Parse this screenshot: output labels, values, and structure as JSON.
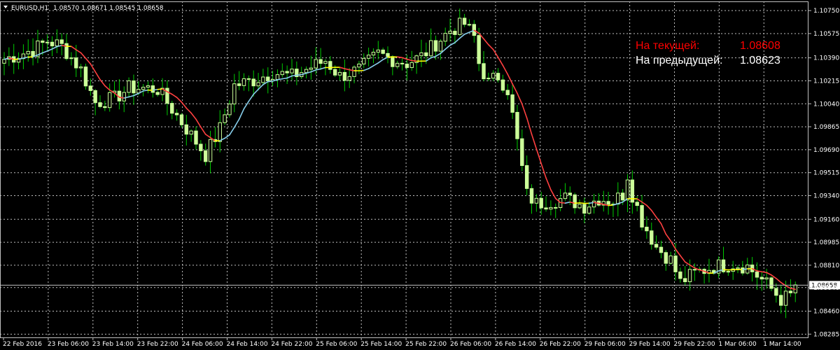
{
  "header": {
    "symbol": "EURUSD,H1",
    "ohlc": "1.08570 1.08671 1.08545 1.08658"
  },
  "info": {
    "current_label": "На текущей:",
    "current_value": "1.08608",
    "current_color": "#ff0000",
    "previous_label": "На предыдущей:",
    "previous_value": "1.08623",
    "previous_color": "#ffffff"
  },
  "colors": {
    "background": "#000000",
    "grid": "#c0c0c0",
    "bull_body": "#000000",
    "bull_outline": "#ccff99",
    "bear_body": "#ccff99",
    "wick": "#00cc00",
    "ma_up": "#87ceeb",
    "ma_down": "#ff4040",
    "ma_flat": "#ffff00",
    "price_line": "#c0c0c0",
    "price_label_bg": "#ffffff",
    "price_label_text": "#000000"
  },
  "chart_data": {
    "type": "candlestick",
    "symbol": "EURUSD",
    "timeframe": "H1",
    "ylim": [
      1.0826,
      1.1082
    ],
    "yticks": [
      "1.10750",
      "1.10575",
      "1.10390",
      "1.10215",
      "1.10040",
      "1.09865",
      "1.09690",
      "1.09515",
      "1.09340",
      "1.09160",
      "1.08985",
      "1.08810",
      "1.08640",
      "1.08460",
      "1.08285"
    ],
    "current_price": "1.08658",
    "xticks": [
      "22 Feb 2016",
      "23 Feb 06:00",
      "23 Feb 14:00",
      "23 Feb 22:00",
      "24 Feb 06:00",
      "24 Feb 14:00",
      "24 Feb 22:00",
      "25 Feb 06:00",
      "25 Feb 14:00",
      "25 Feb 22:00",
      "26 Feb 06:00",
      "26 Feb 14:00",
      "26 Feb 22:00",
      "29 Feb 06:00",
      "29 Feb 14:00",
      "29 Feb 22:00",
      "1 Mar 06:00",
      "1 Mar 14:00"
    ],
    "keypoints": [
      [
        0,
        1.1038
      ],
      [
        6,
        1.1045
      ],
      [
        9,
        1.1052
      ],
      [
        12,
        1.1048
      ],
      [
        16,
        1.103
      ],
      [
        19,
        1.1005
      ],
      [
        23,
        1.1008
      ],
      [
        26,
        1.1016
      ],
      [
        29,
        1.1016
      ],
      [
        32,
        1.1015
      ],
      [
        34,
        1.1005
      ],
      [
        38,
        1.0985
      ],
      [
        40,
        1.0975
      ],
      [
        42,
        1.0965
      ],
      [
        45,
        1.0985
      ],
      [
        48,
        1.1018
      ],
      [
        52,
        1.1022
      ],
      [
        56,
        1.1028
      ],
      [
        60,
        1.1025
      ],
      [
        64,
        1.1032
      ],
      [
        67,
        1.1037
      ],
      [
        70,
        1.1025
      ],
      [
        74,
        1.103
      ],
      [
        78,
        1.1042
      ],
      [
        81,
        1.1038
      ],
      [
        84,
        1.1035
      ],
      [
        87,
        1.104
      ],
      [
        90,
        1.105
      ],
      [
        93,
        1.106
      ],
      [
        96,
        1.1065
      ],
      [
        98,
        1.1055
      ],
      [
        99,
        1.1035
      ],
      [
        101,
        1.102
      ],
      [
        103,
        1.1025
      ],
      [
        105,
        1.1015
      ],
      [
        107,
        1.0975
      ],
      [
        109,
        1.0935
      ],
      [
        111,
        1.0928
      ],
      [
        114,
        1.093
      ],
      [
        117,
        1.0932
      ],
      [
        121,
        1.0926
      ],
      [
        124,
        1.0932
      ],
      [
        127,
        1.093
      ],
      [
        129,
        1.0935
      ],
      [
        130,
        1.095
      ],
      [
        131,
        1.0935
      ],
      [
        133,
        1.0915
      ],
      [
        136,
        1.0895
      ],
      [
        139,
        1.0885
      ],
      [
        141,
        1.0868
      ],
      [
        144,
        1.0875
      ],
      [
        148,
        1.088
      ],
      [
        152,
        1.0882
      ],
      [
        155,
        1.088
      ],
      [
        158,
        1.087
      ],
      [
        160,
        1.0863
      ],
      [
        162,
        1.0855
      ],
      [
        164,
        1.0858
      ],
      [
        165,
        1.0866
      ]
    ]
  }
}
